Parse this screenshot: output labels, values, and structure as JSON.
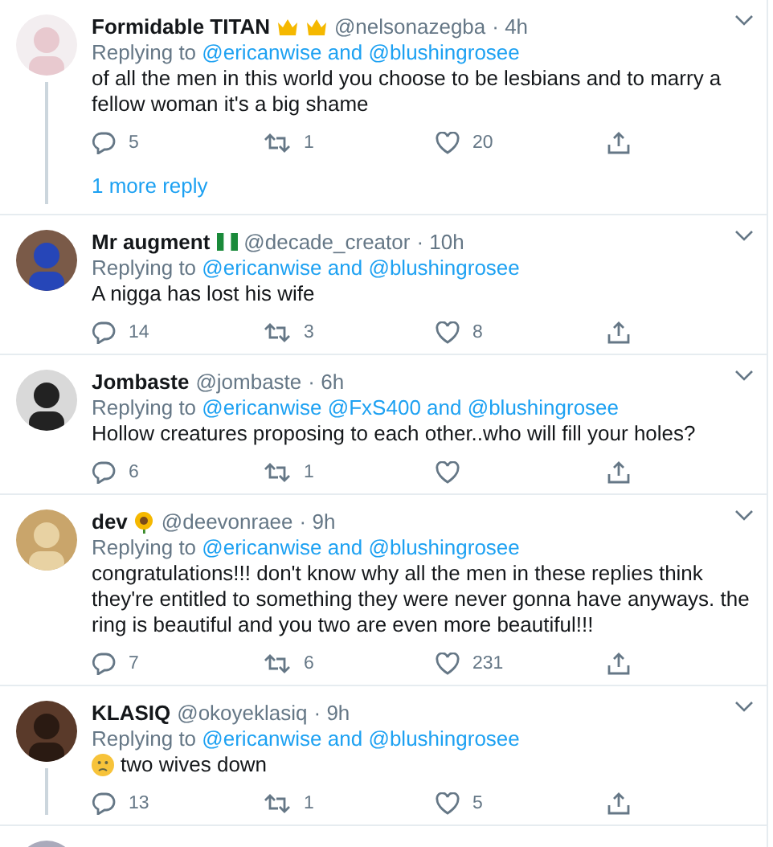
{
  "tweets": [
    {
      "name": "Formidable TITAN",
      "handle": "@nelsonazegba",
      "time": "· 4h",
      "reply_line": [
        {
          "kind": "word",
          "text": "Replying to"
        },
        {
          "kind": "mention",
          "text": "@ericanwise"
        },
        {
          "kind": "mention",
          "text": "and"
        },
        {
          "kind": "mention",
          "text": "@blushingrosee"
        }
      ],
      "body": "of all the men in this world you choose to be lesbians and to marry a fellow woman it's a big shame",
      "replies": "5",
      "retweets": "1",
      "likes": "20",
      "thread": true,
      "more_replies": "1 more reply"
    },
    {
      "name": "Mr augment",
      "handle": "@decade_creator",
      "time": "· 10h",
      "reply_line": [
        {
          "kind": "word",
          "text": "Replying to"
        },
        {
          "kind": "mention",
          "text": "@ericanwise"
        },
        {
          "kind": "mention",
          "text": "and"
        },
        {
          "kind": "mention",
          "text": "@blushingrosee"
        }
      ],
      "body": "A nigga has lost his wife",
      "replies": "14",
      "retweets": "3",
      "likes": "8",
      "thread": false
    },
    {
      "name": "Jombaste",
      "handle": "@jombaste",
      "time": "· 6h",
      "reply_line": [
        {
          "kind": "word",
          "text": "Replying to"
        },
        {
          "kind": "mention",
          "text": "@ericanwise"
        },
        {
          "kind": "mention",
          "text": "@FxS400"
        },
        {
          "kind": "mention",
          "text": "and"
        },
        {
          "kind": "mention",
          "text": "@blushingrosee"
        }
      ],
      "body": "Hollow creatures proposing to each other..who will fill your holes?",
      "replies": "6",
      "retweets": "1",
      "thread": false
    },
    {
      "name": "dev",
      "handle": "@deevonraee",
      "time": "· 9h",
      "reply_line": [
        {
          "kind": "word",
          "text": "Replying to"
        },
        {
          "kind": "mention",
          "text": "@ericanwise"
        },
        {
          "kind": "mention",
          "text": "and"
        },
        {
          "kind": "mention",
          "text": "@blushingrosee"
        }
      ],
      "body": "congratulations!!! don't know why all the men in these replies think they're entitled to something they were never gonna have anyways. the ring is beautiful and you two are even more beautiful!!!",
      "replies": "7",
      "retweets": "6",
      "likes": "231",
      "thread": false
    },
    {
      "name": "KLASIQ",
      "handle": "@okoyeklasiq",
      "time": "· 9h",
      "reply_line": [
        {
          "kind": "word",
          "text": "Replying to"
        },
        {
          "kind": "mention",
          "text": "@ericanwise"
        },
        {
          "kind": "mention",
          "text": "and"
        },
        {
          "kind": "mention",
          "text": "@blushingrosee"
        }
      ],
      "body": "two wives down",
      "replies": "13",
      "retweets": "1",
      "likes": "5",
      "thread": true
    }
  ]
}
